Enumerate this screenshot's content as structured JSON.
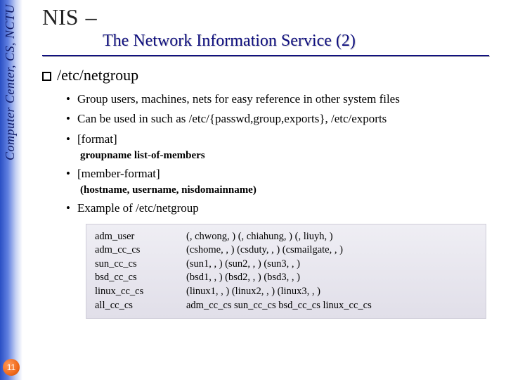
{
  "sidebar": {
    "label": "Computer Center, CS, NCTU",
    "page_number": "11"
  },
  "title": {
    "main": "NIS",
    "dash": "–",
    "subtitle": "The Network Information Service (2)"
  },
  "section": {
    "heading": "/etc/netgroup",
    "bullets": {
      "b1": "Group users, machines, nets for easy reference in other system files",
      "b2": "Can be used in such as /etc/{passwd,group,exports}, /etc/exports",
      "b3": "[format]",
      "b3_sub": "groupname list-of-members",
      "b4": "[member-format]",
      "b4_sub": "(hostname, username, nisdomainname)",
      "b5": "Example of /etc/netgroup"
    }
  },
  "example": {
    "rows": [
      {
        "name": "adm_user",
        "value": "(, chwong, ) (, chiahung, ) (, liuyh, )"
      },
      {
        "name": "adm_cc_cs",
        "value": "(cshome, , ) (csduty, , ) (csmailgate, , )"
      },
      {
        "name": "sun_cc_cs",
        "value": "(sun1, , ) (sun2, , ) (sun3, , )"
      },
      {
        "name": "bsd_cc_cs",
        "value": "(bsd1, , ) (bsd2, , ) (bsd3, , )"
      },
      {
        "name": "linux_cc_cs",
        "value": "(linux1, , ) (linux2, , ) (linux3, , )"
      },
      {
        "name": "all_cc_cs",
        "value": "adm_cc_cs sun_cc_cs bsd_cc_cs linux_cc_cs"
      }
    ]
  }
}
